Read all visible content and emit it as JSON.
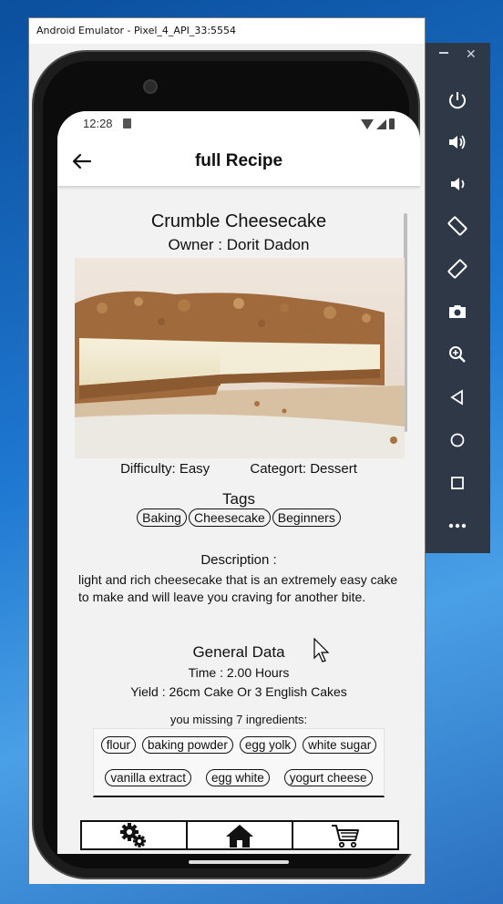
{
  "window": {
    "title": "Android Emulator - Pixel_4_API_33:5554"
  },
  "status_bar": {
    "time": "12:28"
  },
  "app_bar": {
    "title": "full Recipe",
    "back_icon": "arrow-left-icon"
  },
  "recipe": {
    "name": "Crumble Cheesecake",
    "owner": "Owner : Dorit Dadon",
    "difficulty": "Difficulty: Easy",
    "category": "Categort: Dessert",
    "tags_title": "Tags",
    "tags": [
      "Baking",
      "Cheesecake",
      "Beginners"
    ],
    "description_title": "Description :",
    "description": "light and rich cheesecake that is an extremely easy cake to make and will leave you craving for another bite.",
    "general_title": "General Data",
    "time": "Time : 2.00 Hours",
    "yield": "Yield : 26cm Cake Or 3 English Cakes",
    "missing_title": "you missing 7 ingredients:",
    "missing_ingredients_row1": [
      "flour",
      "baking powder",
      "egg yolk",
      "white sugar"
    ],
    "missing_ingredients_row2": [
      "vanilla extract",
      "egg white",
      "yogurt cheese"
    ]
  },
  "bottom_nav": {
    "items": [
      {
        "icon": "gears-icon"
      },
      {
        "icon": "home-icon"
      },
      {
        "icon": "cart-icon"
      }
    ]
  },
  "side_panel": {
    "buttons": [
      "power-icon",
      "volume-up-icon",
      "volume-down-icon",
      "rotate-left-icon",
      "rotate-right-icon",
      "camera-icon",
      "zoom-icon",
      "back-icon",
      "home-circle-icon",
      "overview-icon",
      "more-icon"
    ]
  },
  "colors": {
    "side_panel": "#2e3846",
    "screen_bg": "#f2f2f2"
  }
}
